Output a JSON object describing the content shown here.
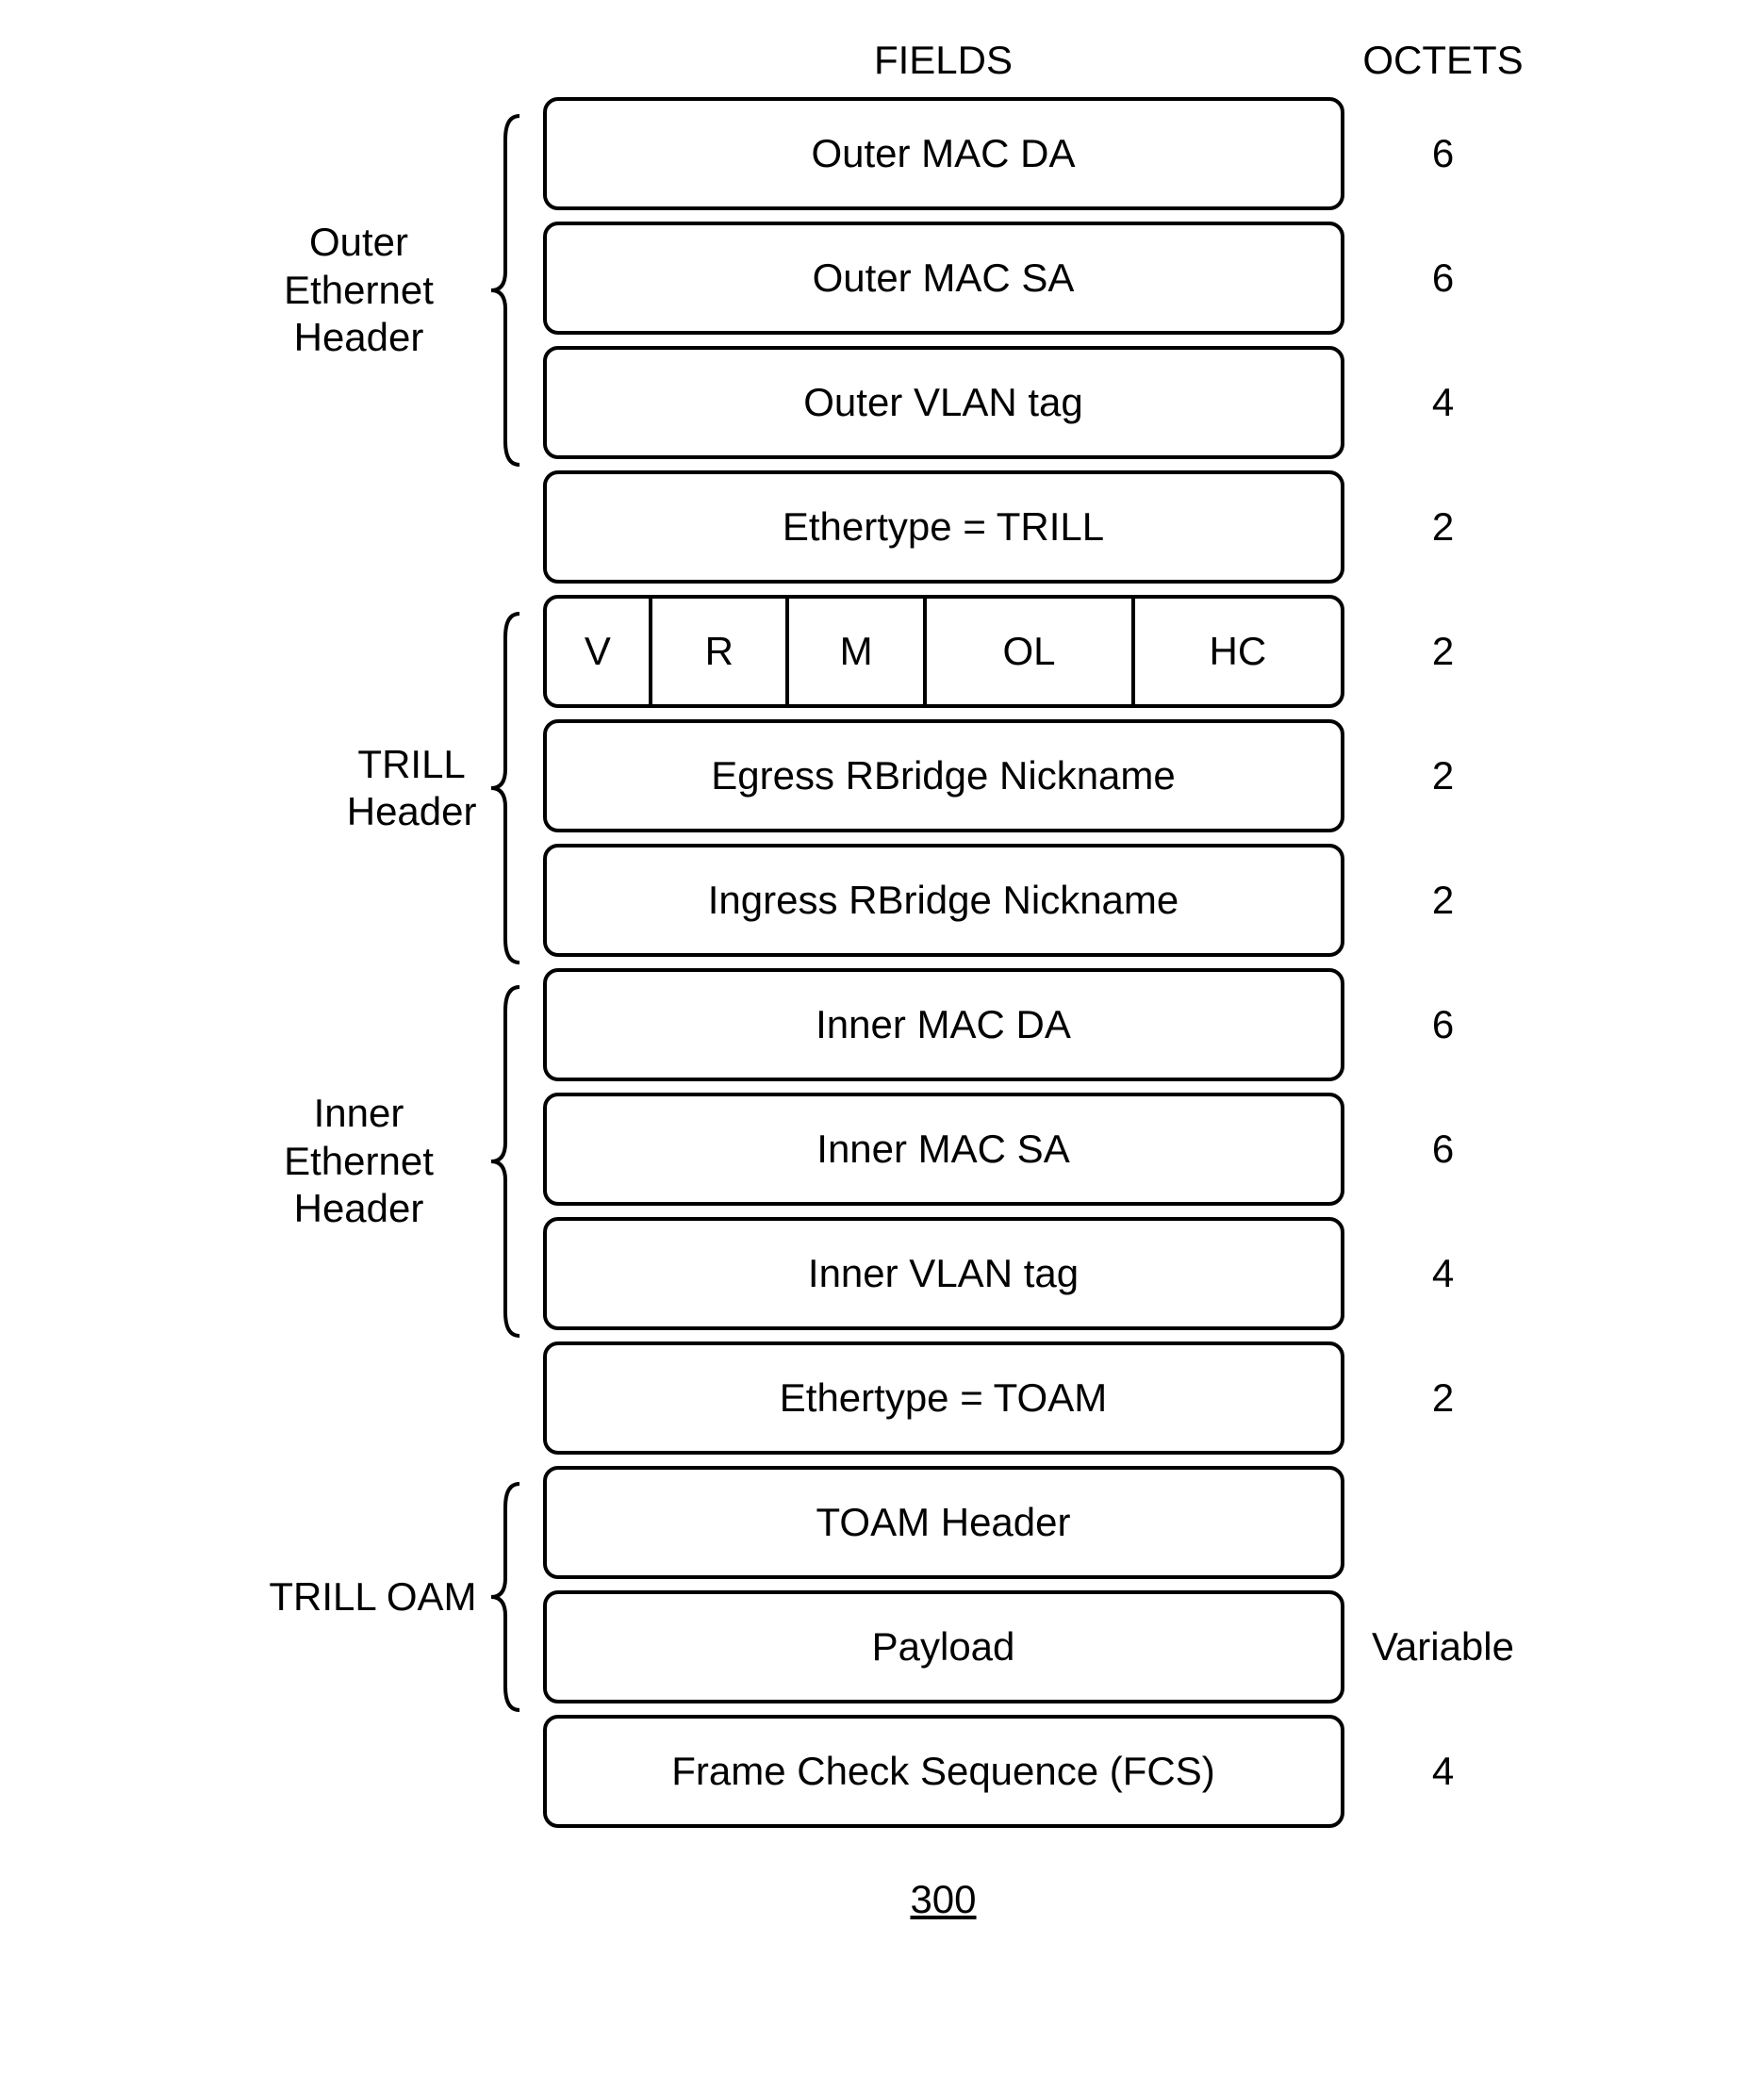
{
  "headers": {
    "fields": "FIELDS",
    "octets": "OCTETS"
  },
  "groupLabels": {
    "outerEthernet": "Outer Ethernet\nHeader",
    "trillHeader": "TRILL\nHeader",
    "innerEthernet": "Inner Ethernet\nHeader",
    "trillOam": "TRILL OAM"
  },
  "fields": [
    {
      "label": "Outer MAC DA",
      "octets": "6"
    },
    {
      "label": "Outer MAC SA",
      "octets": "6"
    },
    {
      "label": "Outer VLAN tag",
      "octets": "4"
    },
    {
      "label": "Ethertype = TRILL",
      "octets": "2"
    },
    {
      "split": [
        "V",
        "R",
        "M",
        "OL",
        "HC"
      ],
      "octets": "2"
    },
    {
      "label": "Egress RBridge Nickname",
      "octets": "2"
    },
    {
      "label": "Ingress RBridge Nickname",
      "octets": "2"
    },
    {
      "label": "Inner MAC DA",
      "octets": "6"
    },
    {
      "label": "Inner MAC SA",
      "octets": "6"
    },
    {
      "label": "Inner VLAN tag",
      "octets": "4"
    },
    {
      "label": "Ethertype = TOAM",
      "octets": "2"
    },
    {
      "label": "TOAM Header",
      "octets": ""
    },
    {
      "label": "Payload",
      "octets": "Variable"
    },
    {
      "label": "Frame Check Sequence (FCS)",
      "octets": "4"
    }
  ],
  "figureNumber": "300"
}
